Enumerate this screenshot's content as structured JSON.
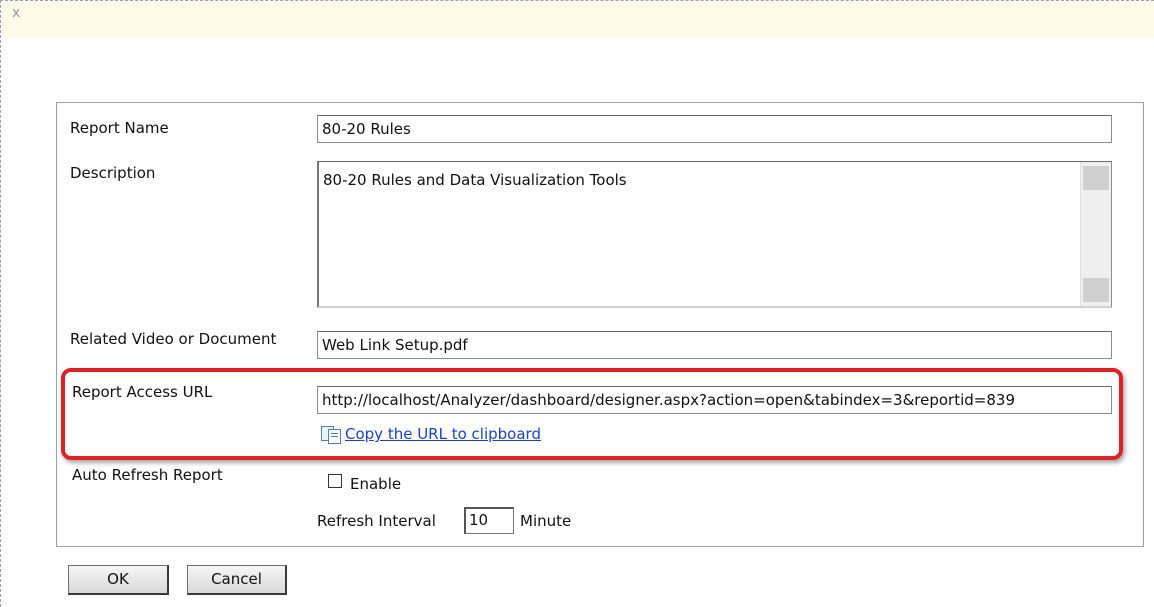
{
  "titlebar": {
    "close_label": "x"
  },
  "form": {
    "report_name": {
      "label": "Report Name",
      "value": "80-20 Rules"
    },
    "description": {
      "label": "Description",
      "value": "80-20 Rules and Data Visualization Tools"
    },
    "related": {
      "label": "Related Video or Document",
      "value": "Web Link Setup.pdf"
    },
    "access_url": {
      "label": "Report Access URL",
      "value": "http://localhost/Analyzer/dashboard/designer.aspx?action=open&tabindex=3&reportid=839",
      "copy_link": "Copy the URL to clipboard"
    },
    "auto_refresh": {
      "label": "Auto Refresh Report",
      "enable_label": "Enable",
      "interval_label": "Refresh Interval",
      "interval_value": "10",
      "unit_label": "Minute"
    }
  },
  "buttons": {
    "ok": "OK",
    "cancel": "Cancel"
  },
  "colors": {
    "title_bar": "#fffbe6",
    "highlight": "#dd2222",
    "link": "#1a3ed6"
  }
}
